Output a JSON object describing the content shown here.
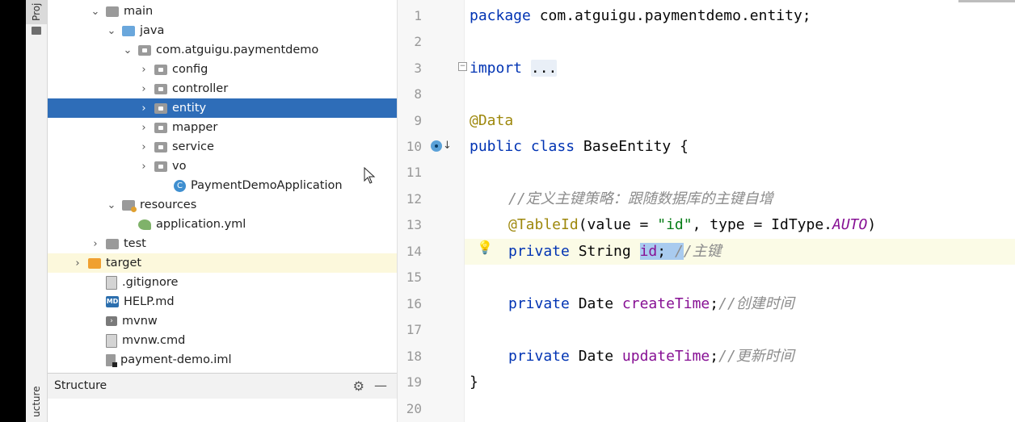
{
  "toolstrip": {
    "project_tab": "Proj",
    "structure_tab": "ucture"
  },
  "tree": [
    {
      "label": "main",
      "chev": "⌄",
      "icon": "folder-gray"
    },
    {
      "label": "java",
      "chev": "⌄",
      "icon": "folder-blue"
    },
    {
      "label": "com.atguigu.paymentdemo",
      "chev": "⌄",
      "icon": "package"
    },
    {
      "label": "config",
      "chev": "›",
      "icon": "package"
    },
    {
      "label": "controller",
      "chev": "›",
      "icon": "package"
    },
    {
      "label": "entity",
      "chev": "›",
      "icon": "package",
      "selected": true
    },
    {
      "label": "mapper",
      "chev": "›",
      "icon": "package"
    },
    {
      "label": "service",
      "chev": "›",
      "icon": "package"
    },
    {
      "label": "vo",
      "chev": "›",
      "icon": "package"
    },
    {
      "label": "PaymentDemoApplication",
      "chev": "",
      "icon": "class"
    },
    {
      "label": "resources",
      "chev": "⌄",
      "icon": "res"
    },
    {
      "label": "application.yml",
      "chev": "",
      "icon": "yml"
    },
    {
      "label": "test",
      "chev": "›",
      "icon": "folder-gray"
    },
    {
      "label": "target",
      "chev": "›",
      "icon": "folder-orange"
    },
    {
      "label": ".gitignore",
      "chev": "",
      "icon": "doc"
    },
    {
      "label": "HELP.md",
      "chev": "",
      "icon": "md"
    },
    {
      "label": "mvnw",
      "chev": "",
      "icon": "term"
    },
    {
      "label": "mvnw.cmd",
      "chev": "",
      "icon": "doc"
    },
    {
      "label": "payment-demo.iml",
      "chev": "",
      "icon": "iml"
    }
  ],
  "structure": {
    "title": "Structure"
  },
  "editor": {
    "line_numbers": [
      "1",
      "2",
      "3",
      "8",
      "9",
      "10",
      "11",
      "12",
      "13",
      "14",
      "15",
      "16",
      "17",
      "18",
      "19",
      "20"
    ],
    "code": {
      "l1_kw": "package",
      "l1_rest": " com.atguigu.paymentdemo.entity;",
      "l3_kw": "import",
      "l3_fold": "...",
      "l9_ann": "@Data",
      "l10_kw1": "public",
      "l10_kw2": "class",
      "l10_rest": " BaseEntity {",
      "l12_cmt": "//定义主键策略：跟随数据库的主键自增",
      "l13_ann": "@TableId",
      "l13_a": "(value = ",
      "l13_str": "\"id\"",
      "l13_b": ", type = IdType.",
      "l13_cst": "AUTO",
      "l13_c": ")",
      "l14_kw": "private",
      "l14_type": " String ",
      "l14_fld": "id",
      "l14_semi": ";",
      "l14_sp": " ",
      "l14_cmt_sel": "/",
      "l14_cmt": "/主键",
      "l16_kw": "private",
      "l16_type": " Date ",
      "l16_fld": "createTime",
      "l16_semi": ";",
      "l16_cmt": "//创建时间",
      "l18_kw": "private",
      "l18_type": " Date ",
      "l18_fld": "updateTime",
      "l18_semi": ";",
      "l18_cmt": "//更新时间",
      "l19": "}"
    }
  }
}
